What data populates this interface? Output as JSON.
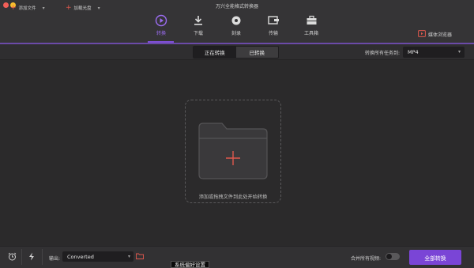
{
  "app": {
    "title": "万兴全能格式转换器"
  },
  "nav": {
    "tabs": [
      {
        "label": "转换",
        "icon": "convert-icon",
        "active": true
      },
      {
        "label": "下载",
        "icon": "download-icon",
        "active": false
      },
      {
        "label": "刻录",
        "icon": "burn-disc-icon",
        "active": false
      },
      {
        "label": "传输",
        "icon": "transfer-icon",
        "active": false
      },
      {
        "label": "工具箱",
        "icon": "toolbox-icon",
        "active": false
      }
    ],
    "media_browser": "媒体浏览器"
  },
  "toolbar": {
    "add_file": "添加文件",
    "load_disc": "加载光盘",
    "segment": {
      "converting": "正在转换",
      "converted": "已转换"
    },
    "convert_all_to_label": "转换所有任务到:",
    "format_value": "MP4"
  },
  "dropzone": {
    "text": "添加或拖拽文件到此处开始转换"
  },
  "bottom": {
    "output_label": "输出:",
    "output_value": "Converted",
    "tooltip": "系统偏好设置",
    "merge_label": "合并所有视频:",
    "merge_enabled": false,
    "convert_all_button": "全部转换"
  },
  "colors": {
    "accent": "#7a45d6",
    "active_tab": "#9b6cf0",
    "plus_red": "#e0584d",
    "background": "#2b2a2b"
  }
}
